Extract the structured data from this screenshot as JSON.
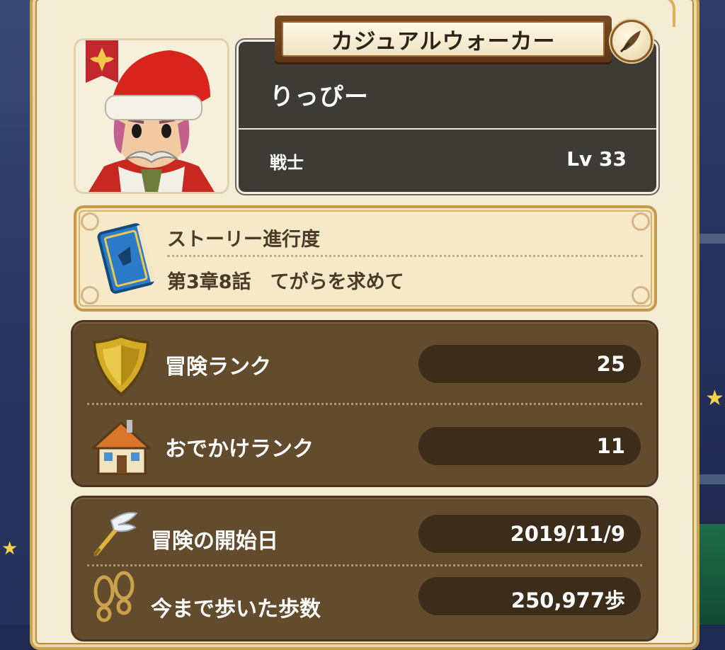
{
  "profile": {
    "title_plate": "カジュアルウォーカー",
    "player_name": "りっぴー",
    "job": "戦士",
    "level": "Lv 33"
  },
  "story": {
    "label": "ストーリー進行度",
    "chapter": "第3章8話　てがらを求めて"
  },
  "ranks": [
    {
      "label": "冒険ランク",
      "value": "25",
      "icon": "shield-icon"
    },
    {
      "label": "おでかけランク",
      "value": "11",
      "icon": "house-icon"
    }
  ],
  "stats": [
    {
      "label": "冒険の開始日",
      "value": "2019/11/9",
      "icon": "winged-sword-icon"
    },
    {
      "label": "今まで歩いた歩数",
      "value": "250,977歩",
      "icon": "footprints-icon"
    }
  ],
  "colors": {
    "panel": "#f5ecd6",
    "section": "#634b2d",
    "name_card": "#3e3a35",
    "gold_border": "#c9a24a"
  }
}
